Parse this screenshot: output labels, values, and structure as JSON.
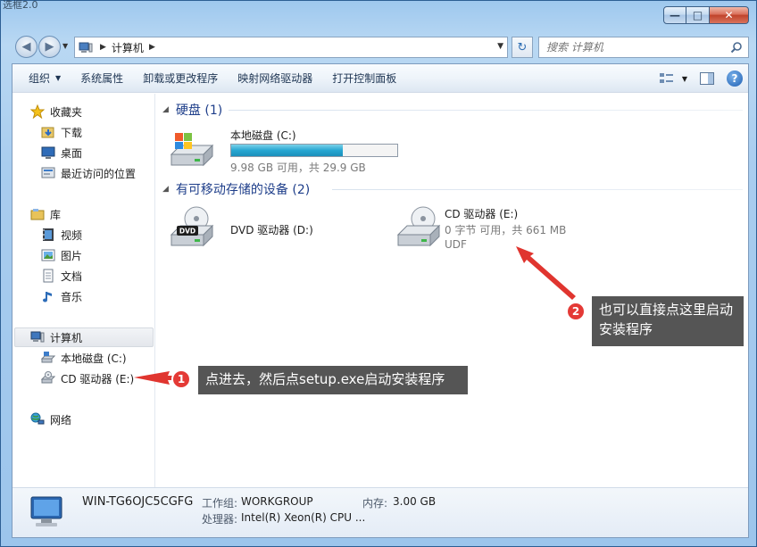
{
  "window": {
    "title_fragment": "选框2.0"
  },
  "navigation": {
    "crumb": "计算机",
    "search_placeholder": "搜索 计算机"
  },
  "toolbar": {
    "organize": "组织",
    "system_properties": "系统属性",
    "uninstall": "卸载或更改程序",
    "map_drive": "映射网络驱动器",
    "control_panel": "打开控制面板"
  },
  "sidebar": {
    "favorites": "收藏夹",
    "downloads": "下载",
    "desktop": "桌面",
    "recent": "最近访问的位置",
    "libraries": "库",
    "videos": "视频",
    "pictures": "图片",
    "documents": "文档",
    "music": "音乐",
    "computer": "计算机",
    "local_disk": "本地磁盘 (C:)",
    "cd_drive": "CD 驱动器 (E:)",
    "network": "网络"
  },
  "groups": {
    "hdd": "硬盘 (1)",
    "removable": "有可移动存储的设备 (2)"
  },
  "drives": {
    "c": {
      "name": "本地磁盘 (C:)",
      "free": "9.98 GB 可用，共 29.9 GB",
      "used_fraction": 0.67
    },
    "dvd": {
      "name": "DVD 驱动器 (D:)",
      "label": "DVD"
    },
    "cd": {
      "name": "CD 驱动器 (E:)",
      "free": "0 字节 可用，共 661 MB",
      "fs": "UDF"
    }
  },
  "details": {
    "name": "WIN-TG6OJC5CGFG",
    "workgroup_label": "工作组:",
    "workgroup": "WORKGROUP",
    "memory_label": "内存:",
    "memory": "3.00 GB",
    "cpu_label": "处理器:",
    "cpu": "Intel(R) Xeon(R) CPU ..."
  },
  "annotations": {
    "one_num": "1",
    "one_text": "点进去，然后点setup.exe启动安装程序",
    "two_num": "2",
    "two_text_a": "也可以直接点这里启动",
    "two_text_b": "安装程序"
  }
}
